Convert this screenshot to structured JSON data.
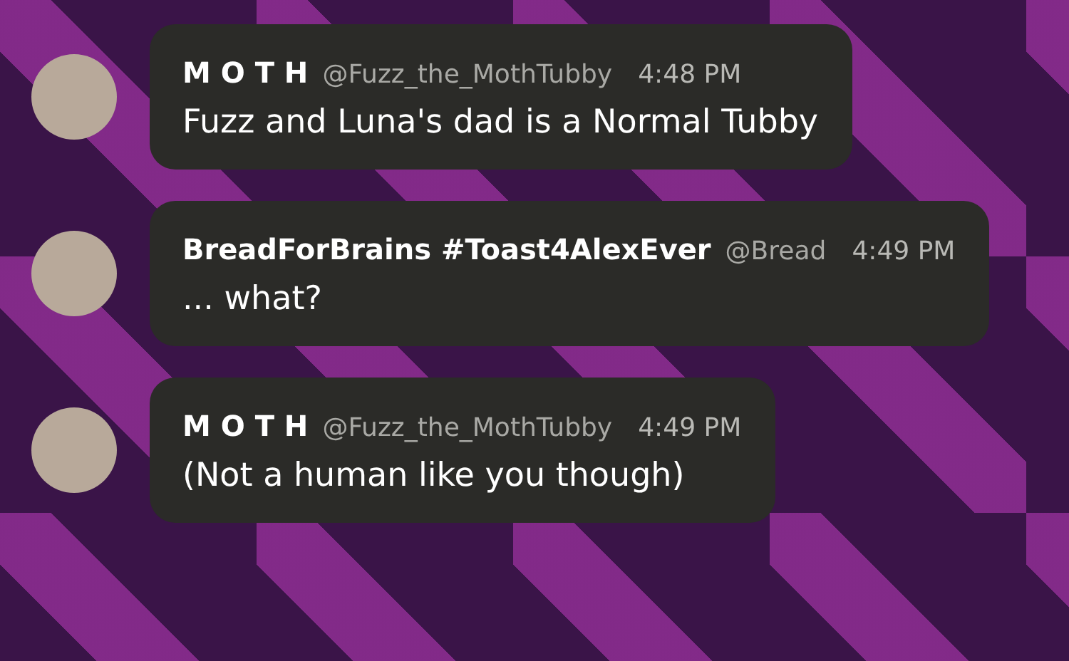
{
  "messages": [
    {
      "author": "M O T H",
      "handle": "@Fuzz_the_MothTubby",
      "time": "4:48 PM",
      "text": "Fuzz and Luna's dad is a Normal Tubby"
    },
    {
      "author": "BreadForBrains #Toast4AlexEver",
      "handle": "@Bread",
      "time": "4:49 PM",
      "text": "... what?"
    },
    {
      "author": "M O T H",
      "handle": "@Fuzz_the_MothTubby",
      "time": "4:49 PM",
      "text": "(Not a human like you though)"
    }
  ]
}
